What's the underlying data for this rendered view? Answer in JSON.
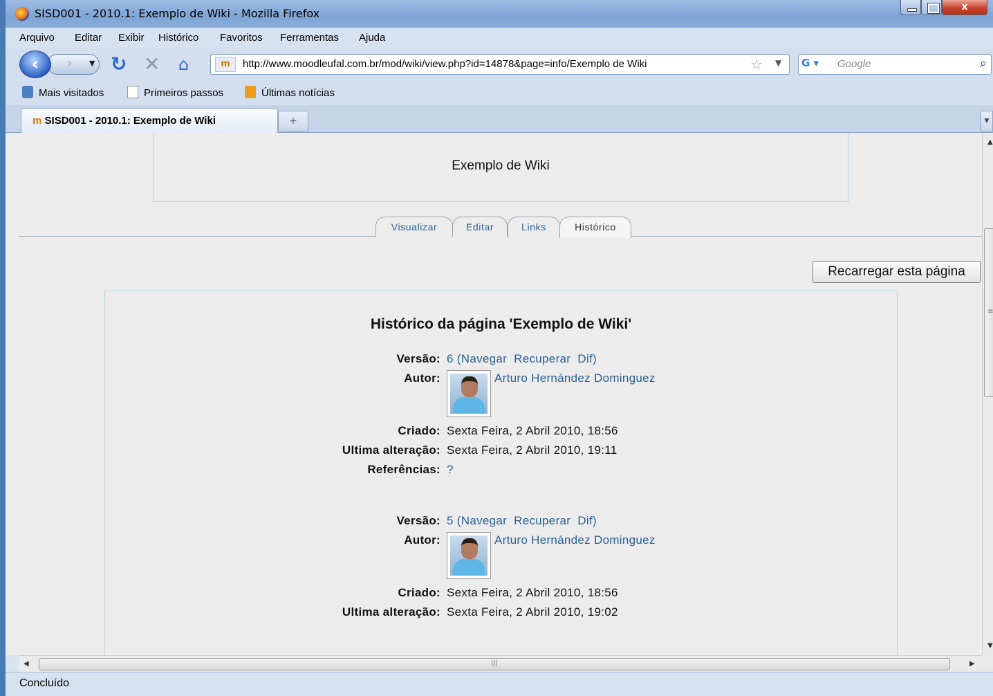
{
  "window": {
    "title": "SISD001 - 2010.1: Exemplo de Wiki - Mozilla Firefox",
    "close_glyph": "x"
  },
  "menu": [
    "Arquivo",
    "Editar",
    "Exibir",
    "Histórico",
    "Favoritos",
    "Ferramentas",
    "Ajuda"
  ],
  "nav": {
    "url": "http://www.moodleufal.com.br/mod/wiki/view.php?id=14878&page=info/Exemplo de Wiki",
    "site_icon": "m",
    "search_placeholder": "Google"
  },
  "bookmarks": [
    "Mais visitados",
    "Primeiros passos",
    "Últimas notícias"
  ],
  "tab": {
    "title": "SISD001 - 2010.1: Exemplo de Wiki",
    "new_tab_glyph": "+"
  },
  "page": {
    "title": "Exemplo de Wiki",
    "tabs": [
      "Visualizar",
      "Editar",
      "Links",
      "Histórico"
    ],
    "reload_button": "Recarregar esta página",
    "history_title": "Histórico da página 'Exemplo de Wiki'",
    "labels": {
      "version": "Versão:",
      "author": "Autor:",
      "created": "Criado:",
      "modified": "Ultima alteração:",
      "references": "Referências:"
    },
    "link_words": {
      "navigate": "Navegar",
      "restore": "Recuperar",
      "diff": "Dif"
    },
    "versions": [
      {
        "number": "6",
        "author": "Arturo Hernández Dominguez",
        "created": "Sexta Feira, 2 Abril 2010, 18:56",
        "modified": "Sexta Feira, 2 Abril 2010, 19:11",
        "references": "?"
      },
      {
        "number": "5",
        "author": "Arturo Hernández Dominguez",
        "created": "Sexta Feira, 2 Abril 2010, 18:56",
        "modified": "Sexta Feira, 2 Abril 2010, 19:02"
      }
    ]
  },
  "status": "Concluído"
}
